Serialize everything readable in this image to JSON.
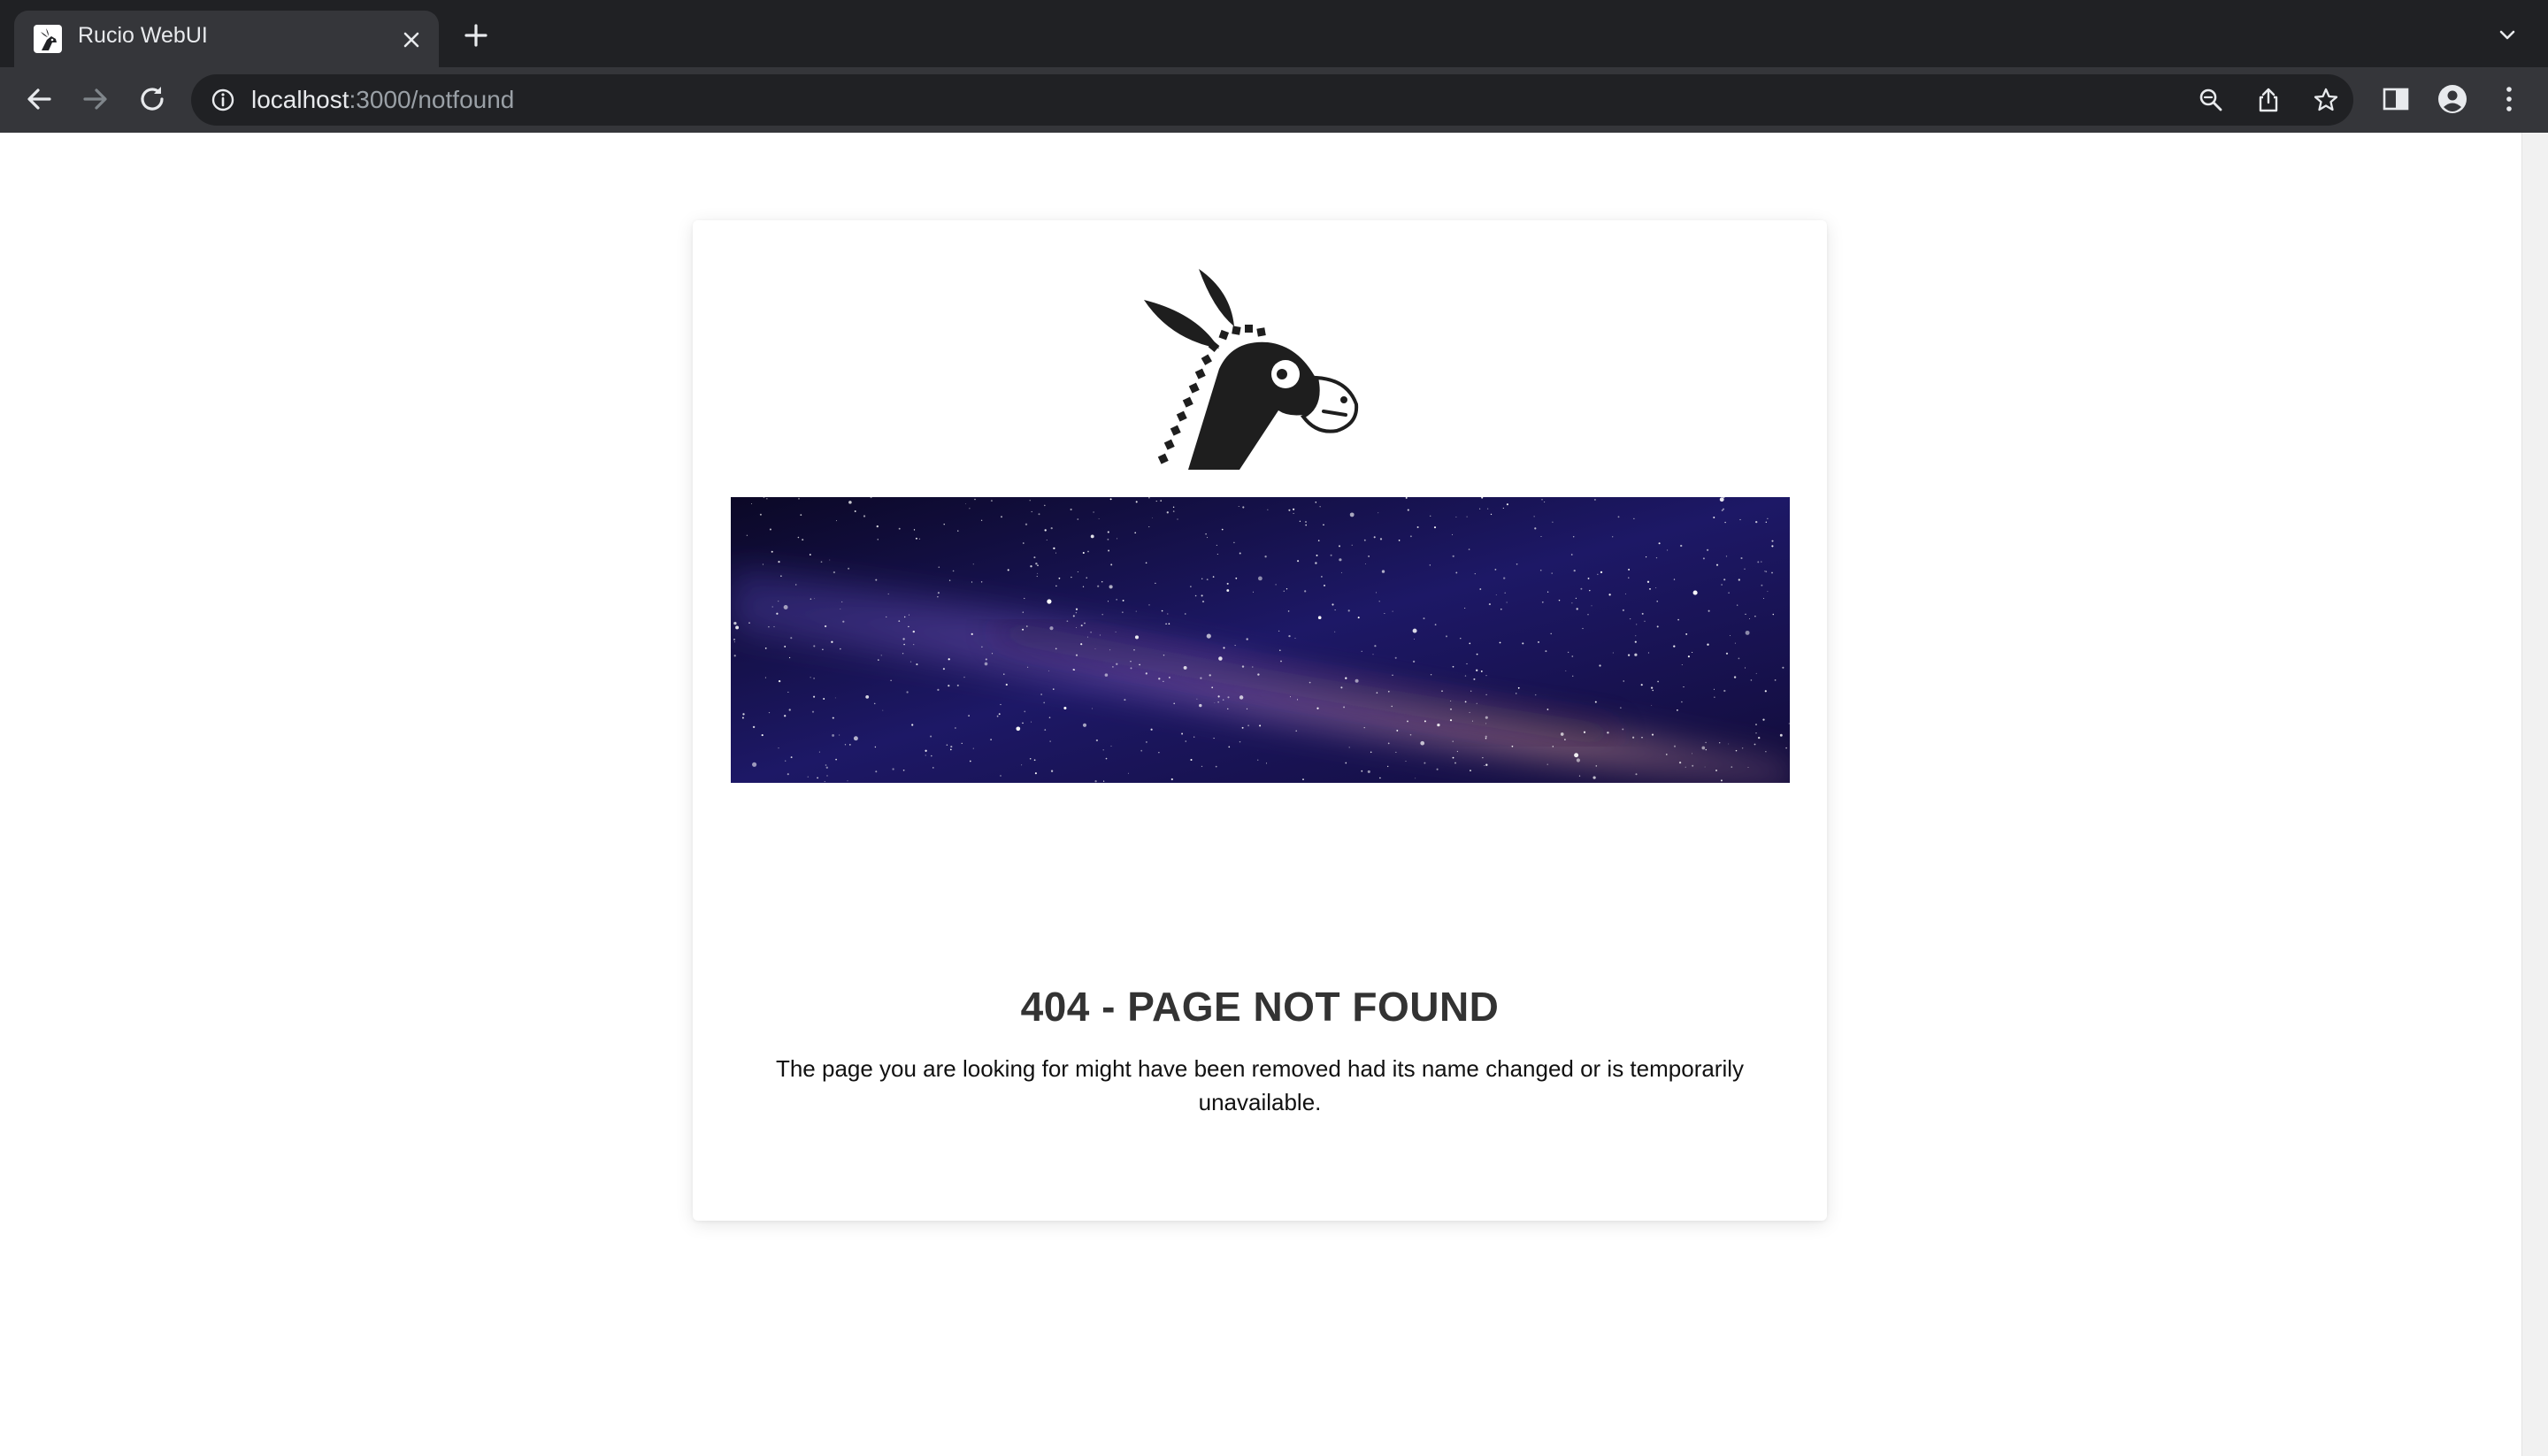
{
  "browser": {
    "tab": {
      "title": "Rucio WebUI",
      "favicon": "rucio-donkey-icon"
    },
    "address_bar": {
      "host": "localhost",
      "path": ":3000/notfound"
    },
    "icons": [
      "back-icon",
      "forward-icon",
      "reload-icon",
      "info-icon",
      "zoom-icon",
      "share-icon",
      "bookmark-star-icon",
      "side-panel-icon",
      "profile-icon",
      "menu-icon",
      "tab-search-icon",
      "new-tab-icon",
      "close-icon"
    ]
  },
  "page": {
    "logo": "rucio-donkey-logo",
    "banner": "milky-way-starfield",
    "title": "404 - PAGE NOT FOUND",
    "message": "The page you are looking for might have been removed had its name changed or is temporarily unavailable."
  },
  "colors": {
    "tabstrip_bg": "#202124",
    "toolbar_bg": "#35363a",
    "title_text": "#333333",
    "banner_bg": "#0d0a2e"
  }
}
